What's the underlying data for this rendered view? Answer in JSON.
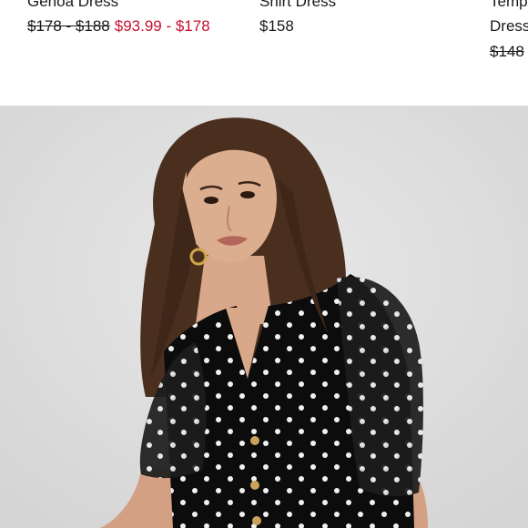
{
  "products": [
    {
      "name": "Genoa Dress",
      "price_original": "$178 - $188",
      "price_sale": "$93.99 - $178"
    },
    {
      "name": "Shirt Dress",
      "price": "$158"
    },
    {
      "name": "Temp",
      "name_line2": "Dress",
      "price_original": "$148"
    }
  ],
  "hero": {
    "description": "Model wearing black polka-dot V-neck dress with sheer puff sleeves"
  }
}
